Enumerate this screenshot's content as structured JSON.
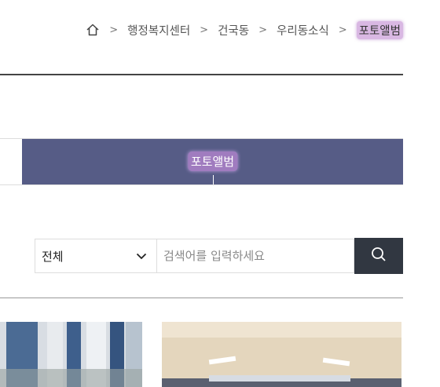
{
  "breadcrumb": {
    "items": [
      "행정복지센터",
      "건국동",
      "우리동소식"
    ],
    "current": "포토앨범"
  },
  "tabs": {
    "active_label": "포토앨범"
  },
  "search": {
    "category_value": "전체",
    "placeholder": "검색어를 입력하세요"
  },
  "colors": {
    "tab_active_bg": "#565c86",
    "search_button_bg": "#313741",
    "highlight": "#d9b8e3"
  }
}
